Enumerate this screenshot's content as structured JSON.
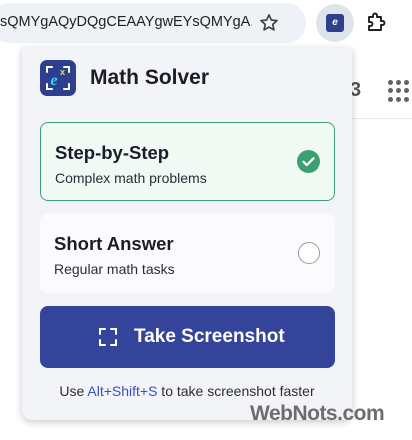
{
  "browser": {
    "url": "sQMYgAQyDQgCEAAYgwEYsQMYgA..."
  },
  "popup": {
    "logo_text": "e",
    "logo_sup": "x",
    "title": "Math Solver",
    "options": [
      {
        "title": "Step-by-Step",
        "subtitle": "Complex math problems",
        "selected": true
      },
      {
        "title": "Short Answer",
        "subtitle": "Regular math tasks",
        "selected": false
      }
    ],
    "button_label": "Take Screenshot",
    "hint_prefix": "Use ",
    "hint_shortcut": "Alt+Shift+S",
    "hint_suffix": " to take screenshot faster"
  },
  "background": {
    "partial_icon": "3"
  },
  "watermark": "WebNots.com",
  "colors": {
    "accent": "#34449a",
    "selected_border": "#3aa072",
    "shortcut": "#3550c8"
  }
}
